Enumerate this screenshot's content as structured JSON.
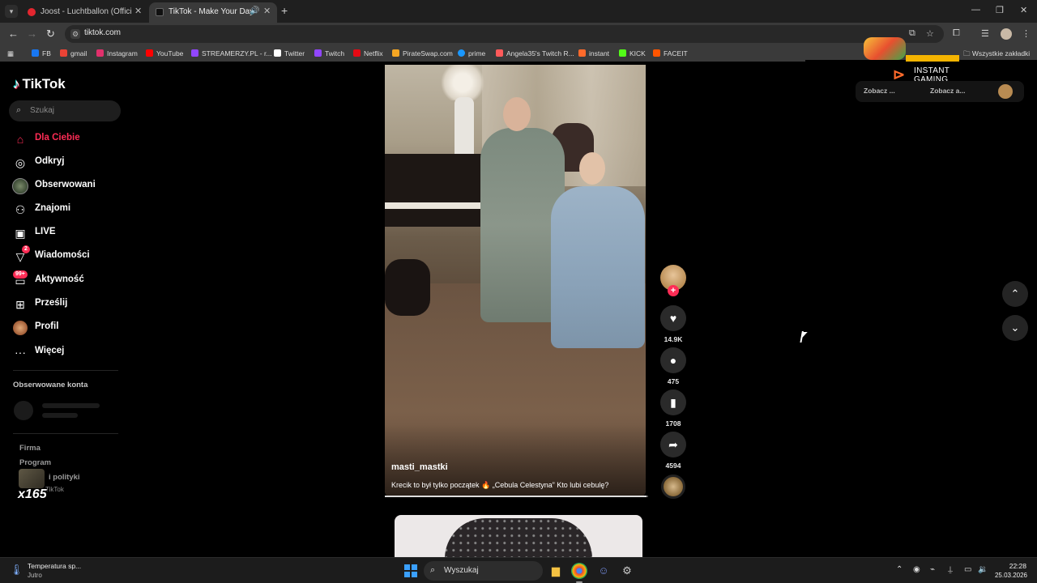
{
  "browser": {
    "tabs": [
      {
        "title": "Joost - Luchtballon (Official Vid"
      },
      {
        "title": "TikTok - Make Your Day"
      }
    ],
    "address": "tiktok.com",
    "bookmarks": [
      {
        "label": "FB",
        "color": "#1877f2"
      },
      {
        "label": "gmail",
        "color": "#ea4335"
      },
      {
        "label": "Instagram",
        "color": "#e1306c"
      },
      {
        "label": "YouTube",
        "color": "#ff0000"
      },
      {
        "label": "STREAMERZY.PL - r...",
        "color": "#9146ff"
      },
      {
        "label": "Twitter",
        "color": "#ffffff"
      },
      {
        "label": "Twitch",
        "color": "#9146ff"
      },
      {
        "label": "Netflix",
        "color": "#e50914"
      },
      {
        "label": "PirateSwap.com",
        "color": "#f5a623"
      },
      {
        "label": "prime",
        "color": "#1a98ff"
      },
      {
        "label": "Angela35's Twitch R...",
        "color": "#ff5a5a"
      },
      {
        "label": "instant",
        "color": "#ff6a2b"
      },
      {
        "label": "KICK",
        "color": "#53fc18"
      },
      {
        "label": "FACEIT",
        "color": "#ff5500"
      }
    ],
    "all_bookmarks": "Wszystkie zakładki"
  },
  "sidebar": {
    "logo": "TikTok",
    "search_placeholder": "Szukaj",
    "nav": [
      {
        "label": "Dla Ciebie",
        "icon": "home-icon",
        "active": true
      },
      {
        "label": "Odkryj",
        "icon": "compass-icon"
      },
      {
        "label": "Obserwowani",
        "icon": "following-avatar-icon"
      },
      {
        "label": "Znajomi",
        "icon": "friends-icon"
      },
      {
        "label": "LIVE",
        "icon": "live-tv-icon"
      },
      {
        "label": "Wiadomości",
        "icon": "messages-icon",
        "badge": "2"
      },
      {
        "label": "Aktywność",
        "icon": "activity-icon",
        "badge": "99+"
      },
      {
        "label": "Prześlij",
        "icon": "upload-icon"
      },
      {
        "label": "Profil",
        "icon": "profile-avatar-icon"
      },
      {
        "label": "Więcej",
        "icon": "more-dots-icon"
      }
    ],
    "followed_title": "Obserwowane konta",
    "footer": {
      "company": "Firma",
      "program": "Program",
      "terms": "i polityki",
      "copyright": "TikTok"
    },
    "overlay_text": "x165"
  },
  "video": {
    "author": "masti_mastki",
    "caption": "Krecik to był tylko początek 🔥 „Cebula Celestyna” Kto lubi cebulę?",
    "progress": 0.995,
    "actions": {
      "likes": "14.9K",
      "comments": "475",
      "saves": "1708",
      "shares": "4594"
    }
  },
  "ad": {
    "brand_line1": "INSTANT",
    "brand_line2": "GAMING",
    "card_left": "Zobacz ...",
    "card_right": "Zobacz a..."
  },
  "taskbar": {
    "weather_title": "Temperatura sp...",
    "weather_sub": "Jutro",
    "search_placeholder": "Wyszukaj",
    "time": "22:28",
    "date": "25.03.2026"
  },
  "colors": {
    "accent": "#fe2c55",
    "background": "#000000"
  }
}
